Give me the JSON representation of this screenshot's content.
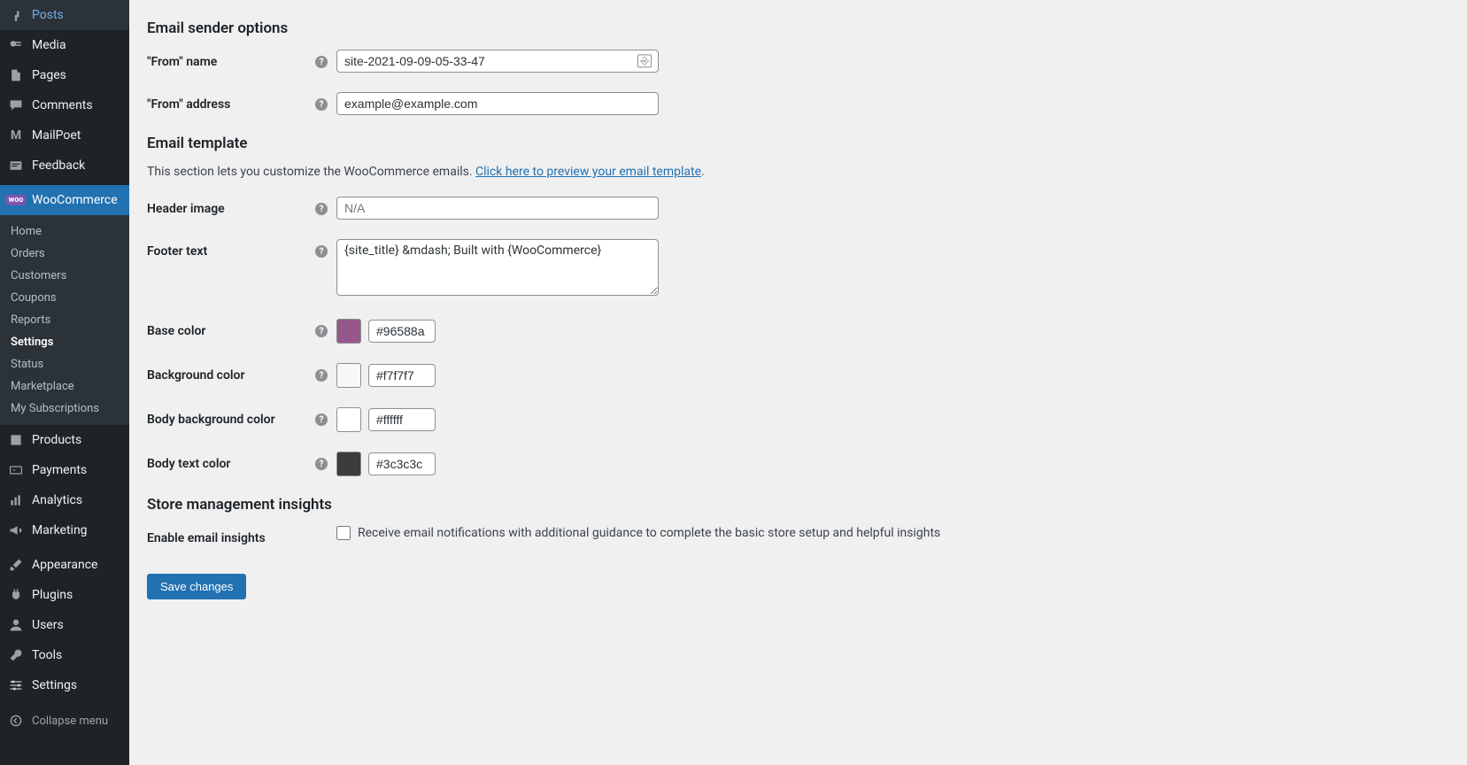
{
  "sidebar": {
    "items": [
      {
        "icon": "pin",
        "label": "Posts"
      },
      {
        "icon": "media",
        "label": "Media"
      },
      {
        "icon": "page",
        "label": "Pages"
      },
      {
        "icon": "comment",
        "label": "Comments"
      },
      {
        "icon": "mailpoet",
        "label": "MailPoet"
      },
      {
        "icon": "feedback",
        "label": "Feedback"
      },
      {
        "icon": "woo",
        "label": "WooCommerce"
      },
      {
        "icon": "products",
        "label": "Products"
      },
      {
        "icon": "payments",
        "label": "Payments"
      },
      {
        "icon": "analytics",
        "label": "Analytics"
      },
      {
        "icon": "marketing",
        "label": "Marketing"
      },
      {
        "icon": "appearance",
        "label": "Appearance"
      },
      {
        "icon": "plugins",
        "label": "Plugins"
      },
      {
        "icon": "users",
        "label": "Users"
      },
      {
        "icon": "tools",
        "label": "Tools"
      },
      {
        "icon": "settings",
        "label": "Settings"
      }
    ],
    "sub": [
      "Home",
      "Orders",
      "Customers",
      "Coupons",
      "Reports",
      "Settings",
      "Status",
      "Marketplace",
      "My Subscriptions"
    ],
    "collapse": "Collapse menu"
  },
  "sections": {
    "sender": {
      "heading": "Email sender options",
      "from_name_label": "\"From\" name",
      "from_name_value": "site-2021-09-09-05-33-47",
      "from_address_label": "\"From\" address",
      "from_address_value": "example@example.com"
    },
    "template": {
      "heading": "Email template",
      "desc_prefix": "This section lets you customize the WooCommerce emails. ",
      "desc_link": "Click here to preview your email template",
      "desc_suffix": ".",
      "header_image_label": "Header image",
      "header_image_placeholder": "N/A",
      "footer_text_label": "Footer text",
      "footer_text_value": "{site_title} &mdash; Built with {WooCommerce}",
      "base_color_label": "Base color",
      "base_color_value": "#96588a",
      "bg_color_label": "Background color",
      "bg_color_value": "#f7f7f7",
      "body_bg_label": "Body background color",
      "body_bg_value": "#ffffff",
      "body_text_label": "Body text color",
      "body_text_value": "#3c3c3c"
    },
    "insights": {
      "heading": "Store management insights",
      "enable_label": "Enable email insights",
      "enable_desc": "Receive email notifications with additional guidance to complete the basic store setup and helpful insights"
    },
    "save": "Save changes"
  }
}
